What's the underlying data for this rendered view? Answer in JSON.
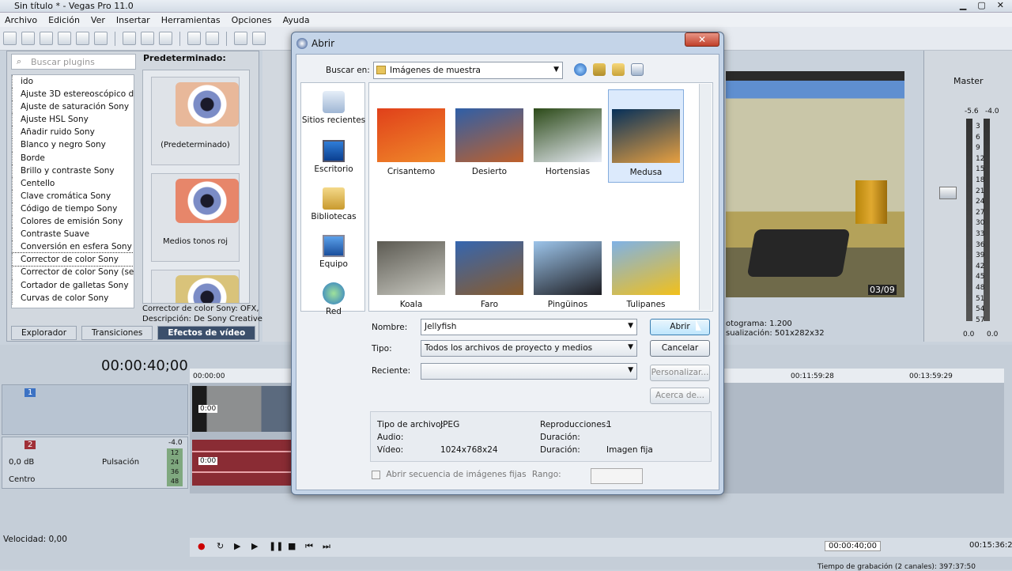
{
  "window": {
    "title": "Sin título * - Vegas Pro 11.0"
  },
  "menu": [
    "Archivo",
    "Edición",
    "Ver",
    "Insertar",
    "Herramientas",
    "Opciones",
    "Ayuda"
  ],
  "plugins": {
    "search_placeholder": "Buscar plugins",
    "items": [
      "ido",
      "Ajuste 3D estereoscópico de",
      "Ajuste de saturación Sony",
      "Ajuste HSL Sony",
      "Añadir ruido Sony",
      "Blanco y negro Sony",
      "Borde",
      "Brillo y contraste Sony",
      "Centello",
      "Clave cromática Sony",
      "Código de tiempo Sony",
      "Colores de emisión Sony",
      "Contraste Suave",
      "Conversión en esfera Sony",
      "Corrector de color Sony",
      "Corrector de color Sony (sec",
      "Cortador de galletas Sony",
      "Curvas de color Sony"
    ],
    "selected_index": 14
  },
  "presets": {
    "title": "Predeterminado:",
    "items": [
      "(Predeterminado)",
      "Medios tonos roj"
    ],
    "description_line1": "Corrector de color Sony: OFX,",
    "description_line2": "Descripción: De Sony Creative"
  },
  "bottom_tabs": [
    "Explorador",
    "Transiciones",
    "Efectos de vídeo"
  ],
  "preview": {
    "line1": "otograma:  1.200",
    "line2": "sualización:  501x282x32",
    "hud_time": "03/09"
  },
  "mixer": {
    "title": "Master",
    "peak_left": "-5.6",
    "peak_right": "-4.0",
    "scale": [
      "3",
      "6",
      "9",
      "12",
      "15",
      "18",
      "21",
      "24",
      "27",
      "30",
      "33",
      "36",
      "39",
      "42",
      "45",
      "48",
      "51",
      "54",
      "57"
    ],
    "bottom_left": "0.0",
    "bottom_right": "0.0"
  },
  "timeline": {
    "timecode": "00:00:40;00",
    "ruler": [
      "00:00:00",
      "00:11:59:28",
      "00:13:59:29"
    ],
    "track1": {
      "number": "1",
      "clip_time": "0:00"
    },
    "track2": {
      "number": "2",
      "volume": "0,0 dB",
      "effect": "Pulsación",
      "pan": "Centro",
      "peak": "-4.0",
      "levels": [
        "12",
        "24",
        "36",
        "48"
      ],
      "clip_time": "0:00"
    },
    "velocity": "Velocidad: 0,00",
    "transport_time": "00:00:40;00",
    "right_time": "00:15:36:26",
    "status": "Tiempo de grabación (2 canales): 397:37:50"
  },
  "dialog": {
    "title": "Abrir",
    "close_glyph": "✕",
    "lookin_label": "Buscar en:",
    "lookin_value": "Imágenes de muestra",
    "places": [
      "Sitios recientes",
      "Escritorio",
      "Bibliotecas",
      "Equipo",
      "Red"
    ],
    "files": [
      {
        "name": "Crisantemo",
        "color1": "#e0401a",
        "color2": "#f08a2a"
      },
      {
        "name": "Desierto",
        "color1": "#2e5fa8",
        "color2": "#c0602a"
      },
      {
        "name": "Hortensias",
        "color1": "#2c4a18",
        "color2": "#e8ecf5"
      },
      {
        "name": "Medusa",
        "color1": "#06305a",
        "color2": "#e8a040"
      },
      {
        "name": "Koala",
        "color1": "#5c5a52",
        "color2": "#c8c8c0"
      },
      {
        "name": "Faro",
        "color1": "#3566b0",
        "color2": "#8a5b2a"
      },
      {
        "name": "Pingüinos",
        "color1": "#9cc4ea",
        "color2": "#1d1d22"
      },
      {
        "name": "Tulipanes",
        "color1": "#7fb2e6",
        "color2": "#f2c01a"
      }
    ],
    "selected_file": "Medusa",
    "name_label": "Nombre:",
    "name_value": "Jellyfish",
    "type_label": "Tipo:",
    "type_value": "Todos los archivos de proyecto y medios",
    "recent_label": "Reciente:",
    "recent_value": "",
    "open_button": "Abrir",
    "cancel_button": "Cancelar",
    "customize_button": "Personalizar...",
    "about_button": "Acerca de...",
    "info": {
      "filetype_label": "Tipo de archivo:",
      "filetype_value": "JPEG",
      "audio_label": "Audio:",
      "video_label": "Vídeo:",
      "video_value": "1024x768x24",
      "plays_label": "Reproducciones:",
      "plays_value": "1",
      "duration1_label": "Duración:",
      "duration2_label": "Duración:",
      "duration2_value": "Imagen fija"
    },
    "sequence_label": "Abrir secuencia de imágenes fijas",
    "range_label": "Rango:",
    "range_sep": "-"
  }
}
